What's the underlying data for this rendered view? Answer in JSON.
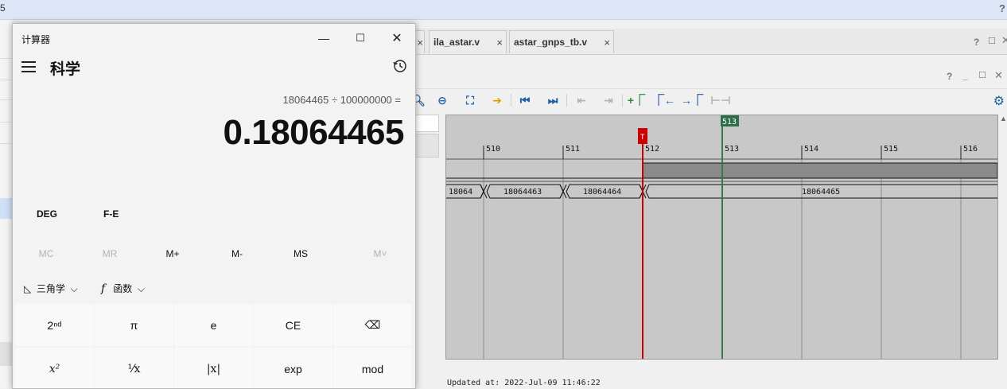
{
  "background": {
    "topbar_number": "5",
    "topbar_help": "?",
    "file_tabs": [
      {
        "label": ""
      },
      {
        "label": "ila_astar.v"
      },
      {
        "label": "astar_gnps_tb.v"
      }
    ],
    "tab_close": "×",
    "window_help": "?",
    "updated_text": "Updated at: 2022-Jul-09 11:46:22"
  },
  "waveform": {
    "time_markers": [
      "510",
      "511",
      "512",
      "513",
      "514",
      "515",
      "516"
    ],
    "trigger_marker": "T",
    "cursor_label": "513",
    "bus_values": [
      "18064",
      "18064463",
      "18064464",
      "18064465"
    ],
    "trigger_color": "#cc0000",
    "cursor_color": "#2e7d4f"
  },
  "calculator": {
    "window_title": "计算器",
    "mode_title": "科学",
    "expression": "18064465 ÷ 100000000 =",
    "result": "0.18064465",
    "angle_unit": "DEG",
    "fe_label": "F-E",
    "memory": [
      {
        "label": "MC",
        "enabled": false
      },
      {
        "label": "MR",
        "enabled": false
      },
      {
        "label": "M+",
        "enabled": true
      },
      {
        "label": "M-",
        "enabled": true
      },
      {
        "label": "MS",
        "enabled": true
      },
      {
        "label": "M˅",
        "enabled": false
      }
    ],
    "trig_label": "三角学",
    "func_label": "函数",
    "func_symbol": "f",
    "keys_row1": [
      "2ⁿᵈ",
      "π",
      "e",
      "CE",
      "⌫"
    ],
    "keys_row2": [
      "x²",
      "¹⁄x",
      "|x|",
      "exp",
      "mod"
    ]
  }
}
